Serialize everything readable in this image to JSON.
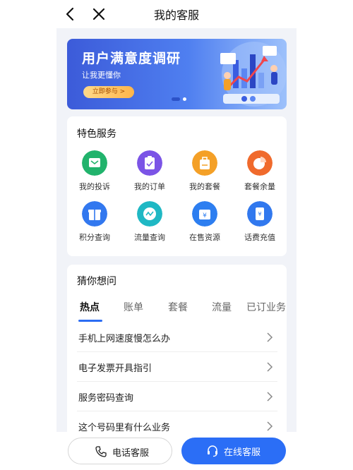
{
  "header": {
    "title": "我的客服",
    "back_icon": "back-arrow-icon",
    "close_icon": "close-icon"
  },
  "banner": {
    "title": "用户满意度调研",
    "subtitle": "让我更懂你",
    "button": "立即参与 >",
    "carousel": {
      "count": 2,
      "active": 1
    }
  },
  "services": {
    "title": "特色服务",
    "items": [
      {
        "label": "我的投诉",
        "icon": "complaint-icon",
        "color": "#21b36c"
      },
      {
        "label": "我的订单",
        "icon": "order-icon",
        "color": "#7b54e6"
      },
      {
        "label": "我的套餐",
        "icon": "package-icon",
        "color": "#f4a027"
      },
      {
        "label": "套餐余量",
        "icon": "pie-chart-icon",
        "color": "#f06a2c"
      },
      {
        "label": "积分查询",
        "icon": "points-icon",
        "color": "#3278ef"
      },
      {
        "label": "流量查询",
        "icon": "traffic-icon",
        "color": "#1fb8c4"
      },
      {
        "label": "在售资源",
        "icon": "shop-icon",
        "color": "#2d7ef0"
      },
      {
        "label": "话费充值",
        "icon": "recharge-icon",
        "color": "#3178ee"
      }
    ]
  },
  "guess": {
    "title": "猜你想问",
    "tabs": [
      "热点",
      "账单",
      "套餐",
      "流量",
      "已订业务"
    ],
    "active_tab": 0,
    "questions": [
      "手机上网速度慢怎么办",
      "电子发票开具指引",
      "服务密码查询",
      "这个号码里有什么业务"
    ]
  },
  "bottom": {
    "phone_label": "电话客服",
    "online_label": "在线客服",
    "accent": "#2b6ef6"
  }
}
